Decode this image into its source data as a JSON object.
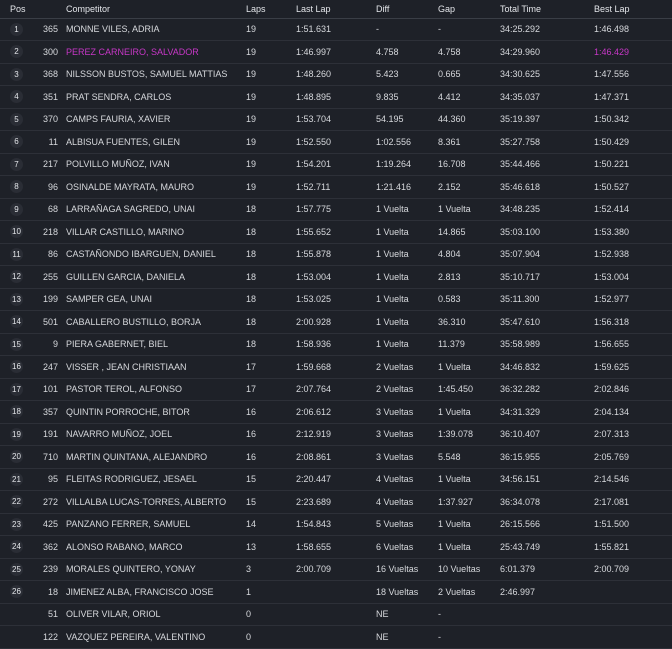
{
  "columns": {
    "pos": "Pos",
    "num": "",
    "competitor": "Competitor",
    "laps": "Laps",
    "last_lap": "Last Lap",
    "diff": "Diff",
    "gap": "Gap",
    "total_time": "Total Time",
    "best_lap": "Best Lap"
  },
  "highlight_color": "#c737c7",
  "rows": [
    {
      "pos": "1",
      "num": "365",
      "competitor": "MONNE VILES, ADRIA",
      "laps": "19",
      "last": "1:51.631",
      "diff": "-",
      "gap": "-",
      "total": "34:25.292",
      "best": "1:46.498"
    },
    {
      "pos": "2",
      "num": "300",
      "competitor": "PEREZ CARNEIRO, SALVADOR",
      "laps": "19",
      "last": "1:46.997",
      "diff": "4.758",
      "gap": "4.758",
      "total": "34:29.960",
      "best": "1:46.429",
      "highlight_competitor": true,
      "highlight_best": true
    },
    {
      "pos": "3",
      "num": "368",
      "competitor": "NILSSON BUSTOS, SAMUEL MATTIAS",
      "laps": "19",
      "last": "1:48.260",
      "diff": "5.423",
      "gap": "0.665",
      "total": "34:30.625",
      "best": "1:47.556"
    },
    {
      "pos": "4",
      "num": "351",
      "competitor": "PRAT SENDRA, CARLOS",
      "laps": "19",
      "last": "1:48.895",
      "diff": "9.835",
      "gap": "4.412",
      "total": "34:35.037",
      "best": "1:47.371"
    },
    {
      "pos": "5",
      "num": "370",
      "competitor": "CAMPS FAURIA, XAVIER",
      "laps": "19",
      "last": "1:53.704",
      "diff": "54.195",
      "gap": "44.360",
      "total": "35:19.397",
      "best": "1:50.342"
    },
    {
      "pos": "6",
      "num": "11",
      "competitor": "ALBISUA FUENTES, GILEN",
      "laps": "19",
      "last": "1:52.550",
      "diff": "1:02.556",
      "gap": "8.361",
      "total": "35:27.758",
      "best": "1:50.429"
    },
    {
      "pos": "7",
      "num": "217",
      "competitor": "POLVILLO MUÑOZ, IVAN",
      "laps": "19",
      "last": "1:54.201",
      "diff": "1:19.264",
      "gap": "16.708",
      "total": "35:44.466",
      "best": "1:50.221"
    },
    {
      "pos": "8",
      "num": "96",
      "competitor": "OSINALDE MAYRATA, MAURO",
      "laps": "19",
      "last": "1:52.711",
      "diff": "1:21.416",
      "gap": "2.152",
      "total": "35:46.618",
      "best": "1:50.527"
    },
    {
      "pos": "9",
      "num": "68",
      "competitor": "LARRAÑAGA SAGREDO, UNAI",
      "laps": "18",
      "last": "1:57.775",
      "diff": "1 Vuelta",
      "gap": "1 Vuelta",
      "total": "34:48.235",
      "best": "1:52.414"
    },
    {
      "pos": "10",
      "num": "218",
      "competitor": "VILLAR CASTILLO, MARINO",
      "laps": "18",
      "last": "1:55.652",
      "diff": "1 Vuelta",
      "gap": "14.865",
      "total": "35:03.100",
      "best": "1:53.380"
    },
    {
      "pos": "11",
      "num": "86",
      "competitor": "CASTAÑONDO IBARGUEN, DANIEL",
      "laps": "18",
      "last": "1:55.878",
      "diff": "1 Vuelta",
      "gap": "4.804",
      "total": "35:07.904",
      "best": "1:52.938"
    },
    {
      "pos": "12",
      "num": "255",
      "competitor": "GUILLEN GARCIA, DANIELA",
      "laps": "18",
      "last": "1:53.004",
      "diff": "1 Vuelta",
      "gap": "2.813",
      "total": "35:10.717",
      "best": "1:53.004"
    },
    {
      "pos": "13",
      "num": "199",
      "competitor": "SAMPER GEA, UNAI",
      "laps": "18",
      "last": "1:53.025",
      "diff": "1 Vuelta",
      "gap": "0.583",
      "total": "35:11.300",
      "best": "1:52.977"
    },
    {
      "pos": "14",
      "num": "501",
      "competitor": "CABALLERO BUSTILLO, BORJA",
      "laps": "18",
      "last": "2:00.928",
      "diff": "1 Vuelta",
      "gap": "36.310",
      "total": "35:47.610",
      "best": "1:56.318"
    },
    {
      "pos": "15",
      "num": "9",
      "competitor": "PIERA GABERNET, BIEL",
      "laps": "18",
      "last": "1:58.936",
      "diff": "1 Vuelta",
      "gap": "11.379",
      "total": "35:58.989",
      "best": "1:56.655"
    },
    {
      "pos": "16",
      "num": "247",
      "competitor": "VISSER , JEAN CHRISTIAAN",
      "laps": "17",
      "last": "1:59.668",
      "diff": "2 Vueltas",
      "gap": "1 Vuelta",
      "total": "34:46.832",
      "best": "1:59.625"
    },
    {
      "pos": "17",
      "num": "101",
      "competitor": "PASTOR TEROL, ALFONSO",
      "laps": "17",
      "last": "2:07.764",
      "diff": "2 Vueltas",
      "gap": "1:45.450",
      "total": "36:32.282",
      "best": "2:02.846"
    },
    {
      "pos": "18",
      "num": "357",
      "competitor": "QUINTIN PORROCHE, BITOR",
      "laps": "16",
      "last": "2:06.612",
      "diff": "3 Vueltas",
      "gap": "1 Vuelta",
      "total": "34:31.329",
      "best": "2:04.134"
    },
    {
      "pos": "19",
      "num": "191",
      "competitor": "NAVARRO MUÑOZ, JOEL",
      "laps": "16",
      "last": "2:12.919",
      "diff": "3 Vueltas",
      "gap": "1:39.078",
      "total": "36:10.407",
      "best": "2:07.313"
    },
    {
      "pos": "20",
      "num": "710",
      "competitor": "MARTIN QUINTANA, ALEJANDRO",
      "laps": "16",
      "last": "2:08.861",
      "diff": "3 Vueltas",
      "gap": "5.548",
      "total": "36:15.955",
      "best": "2:05.769"
    },
    {
      "pos": "21",
      "num": "95",
      "competitor": "FLEITAS RODRIGUEZ, JESAEL",
      "laps": "15",
      "last": "2:20.447",
      "diff": "4 Vueltas",
      "gap": "1 Vuelta",
      "total": "34:56.151",
      "best": "2:14.546"
    },
    {
      "pos": "22",
      "num": "272",
      "competitor": "VILLALBA LUCAS-TORRES, ALBERTO",
      "laps": "15",
      "last": "2:23.689",
      "diff": "4 Vueltas",
      "gap": "1:37.927",
      "total": "36:34.078",
      "best": "2:17.081"
    },
    {
      "pos": "23",
      "num": "425",
      "competitor": "PANZANO FERRER, SAMUEL",
      "laps": "14",
      "last": "1:54.843",
      "diff": "5 Vueltas",
      "gap": "1 Vuelta",
      "total": "26:15.566",
      "best": "1:51.500"
    },
    {
      "pos": "24",
      "num": "362",
      "competitor": "ALONSO RABANO, MARCO",
      "laps": "13",
      "last": "1:58.655",
      "diff": "6 Vueltas",
      "gap": "1 Vuelta",
      "total": "25:43.749",
      "best": "1:55.821"
    },
    {
      "pos": "25",
      "num": "239",
      "competitor": "MORALES QUINTERO, YONAY",
      "laps": "3",
      "last": "2:00.709",
      "diff": "16 Vueltas",
      "gap": "10 Vueltas",
      "total": "6:01.379",
      "best": "2:00.709"
    },
    {
      "pos": "26",
      "num": "18",
      "competitor": "JIMENEZ ALBA, FRANCISCO JOSE",
      "laps": "1",
      "last": "",
      "diff": "18 Vueltas",
      "gap": "2 Vueltas",
      "total": "2:46.997",
      "best": ""
    },
    {
      "pos": "",
      "num": "51",
      "competitor": "OLIVER VILAR, ORIOL",
      "laps": "0",
      "last": "",
      "diff": "NE",
      "gap": "-",
      "total": "",
      "best": ""
    },
    {
      "pos": "",
      "num": "122",
      "competitor": "VAZQUEZ PEREIRA, VALENTINO",
      "laps": "0",
      "last": "",
      "diff": "NE",
      "gap": "-",
      "total": "",
      "best": ""
    }
  ]
}
